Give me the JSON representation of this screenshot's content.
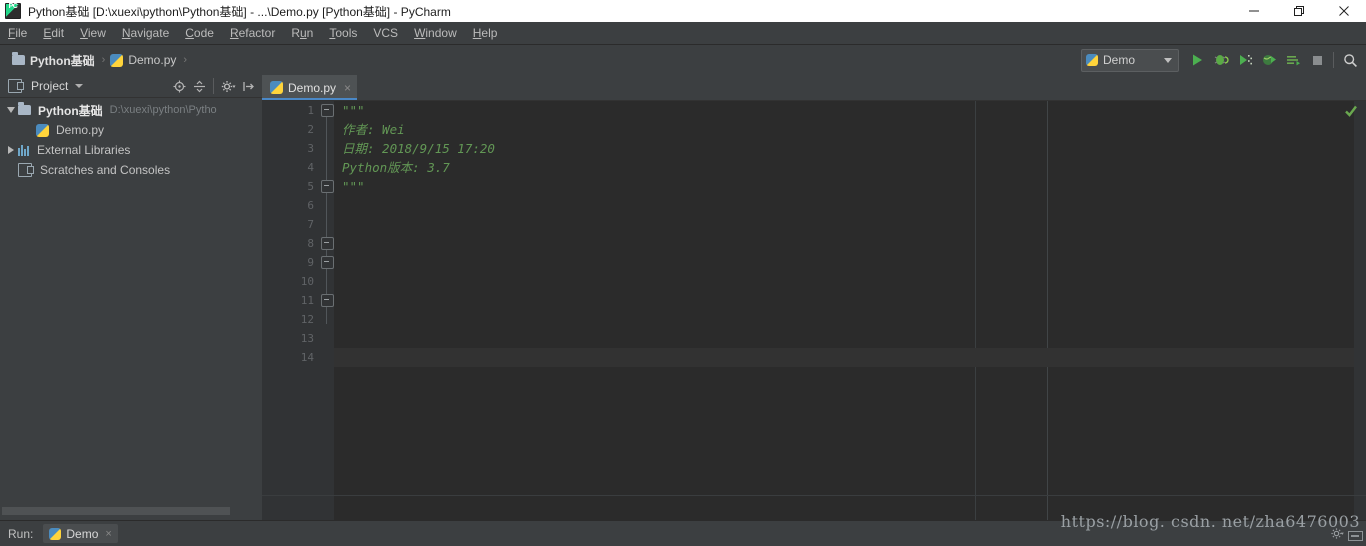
{
  "window": {
    "title": "Python基础 [D:\\xuexi\\python\\Python基础] - ...\\Demo.py [Python基础] - PyCharm",
    "app_icon": "pycharm-logo-icon",
    "controls": {
      "minimize": "minimize-icon",
      "maximize": "maximize-icon",
      "close": "close-icon"
    }
  },
  "menubar": {
    "items": [
      {
        "label": "File",
        "mnemonic": "F"
      },
      {
        "label": "Edit",
        "mnemonic": "E"
      },
      {
        "label": "View",
        "mnemonic": "V"
      },
      {
        "label": "Navigate",
        "mnemonic": "N"
      },
      {
        "label": "Code",
        "mnemonic": "C"
      },
      {
        "label": "Refactor",
        "mnemonic": "R"
      },
      {
        "label": "Run",
        "mnemonic": "u"
      },
      {
        "label": "Tools",
        "mnemonic": "T"
      },
      {
        "label": "VCS",
        "mnemonic": ""
      },
      {
        "label": "Window",
        "mnemonic": "W"
      },
      {
        "label": "Help",
        "mnemonic": "H"
      }
    ]
  },
  "navbar": {
    "breadcrumbs": [
      {
        "label": "Python基础",
        "icon": "folder-icon",
        "bold": true
      },
      {
        "label": "Demo.py",
        "icon": "python-file-icon",
        "bold": false
      }
    ],
    "separator": "›",
    "run_config": {
      "name": "Demo",
      "icon": "python-file-icon",
      "dropdown": "chevron-down-icon"
    },
    "buttons": [
      {
        "name": "run-button",
        "icon": "play-icon"
      },
      {
        "name": "debug-button",
        "icon": "bug-icon"
      },
      {
        "name": "coverage-button",
        "icon": "coverage-icon"
      },
      {
        "name": "profile-button",
        "icon": "profile-icon"
      },
      {
        "name": "show-output-button",
        "icon": "output-icon"
      },
      {
        "name": "stop-button",
        "icon": "stop-icon"
      },
      {
        "name": "search-everywhere",
        "icon": "search-icon"
      }
    ]
  },
  "sidebar": {
    "title": "Project",
    "dropdown": "chevron-down-icon",
    "tools": [
      {
        "name": "scroll-from-source-button",
        "icon": "target-icon"
      },
      {
        "name": "collapse-all-button",
        "icon": "collapse-all-icon"
      },
      {
        "name": "settings-button",
        "icon": "gear-icon"
      },
      {
        "name": "hide-button",
        "icon": "hide-panel-icon"
      }
    ],
    "tree": [
      {
        "label": "Python基础",
        "path": "D:\\xuexi\\python\\Pytho",
        "icon": "folder-icon",
        "arrow": "expanded",
        "bold": true,
        "indent": 0
      },
      {
        "label": "Demo.py",
        "path": "",
        "icon": "python-file-icon",
        "arrow": "none",
        "bold": false,
        "indent": 1
      },
      {
        "label": "External Libraries",
        "path": "",
        "icon": "library-icon",
        "arrow": "collapsed",
        "bold": false,
        "indent": 0
      },
      {
        "label": "Scratches and Consoles",
        "path": "",
        "icon": "scratches-icon",
        "arrow": "none",
        "bold": false,
        "indent": 0
      }
    ]
  },
  "editor": {
    "tabs": [
      {
        "label": "Demo.py",
        "icon": "python-file-icon",
        "close": "×",
        "active": true
      }
    ],
    "inspection_status": "ok-check-icon",
    "current_line": 14,
    "total_lines": 14,
    "line_numbers": [
      "1",
      "2",
      "3",
      "4",
      "5",
      "6",
      "7",
      "8",
      "9",
      "10",
      "11",
      "12",
      "13",
      "14"
    ],
    "fold_markers": [
      1,
      5,
      8,
      9,
      11
    ],
    "lines": [
      {
        "n": 1,
        "text": "\"\"\""
      },
      {
        "n": 2,
        "text": "作者: Wei"
      },
      {
        "n": 3,
        "text": "日期: 2018/9/15 17:20"
      },
      {
        "n": 4,
        "text": "Python版本: 3.7"
      },
      {
        "n": 5,
        "text": "\"\"\""
      },
      {
        "n": 6,
        "text": ""
      },
      {
        "n": 7,
        "text": ""
      },
      {
        "n": 8,
        "text": ""
      },
      {
        "n": 9,
        "text": ""
      },
      {
        "n": 10,
        "text": ""
      },
      {
        "n": 11,
        "text": ""
      },
      {
        "n": 12,
        "text": ""
      },
      {
        "n": 13,
        "text": ""
      },
      {
        "n": 14,
        "text": ""
      }
    ]
  },
  "bottom": {
    "run_label": "Run:",
    "run_tab": {
      "label": "Demo",
      "icon": "python-file-icon",
      "close": "×"
    }
  },
  "watermark": {
    "text": "https://blog. csdn. net/zha6476003"
  },
  "colors": {
    "titlebar_bg": "#ffffff",
    "chrome_bg": "#3c3f41",
    "editor_bg": "#2b2b2b",
    "gutter_bg": "#313335",
    "docstring_green": "#629755",
    "accent_blue": "#4a88c7",
    "run_green": "#3cb44a"
  }
}
